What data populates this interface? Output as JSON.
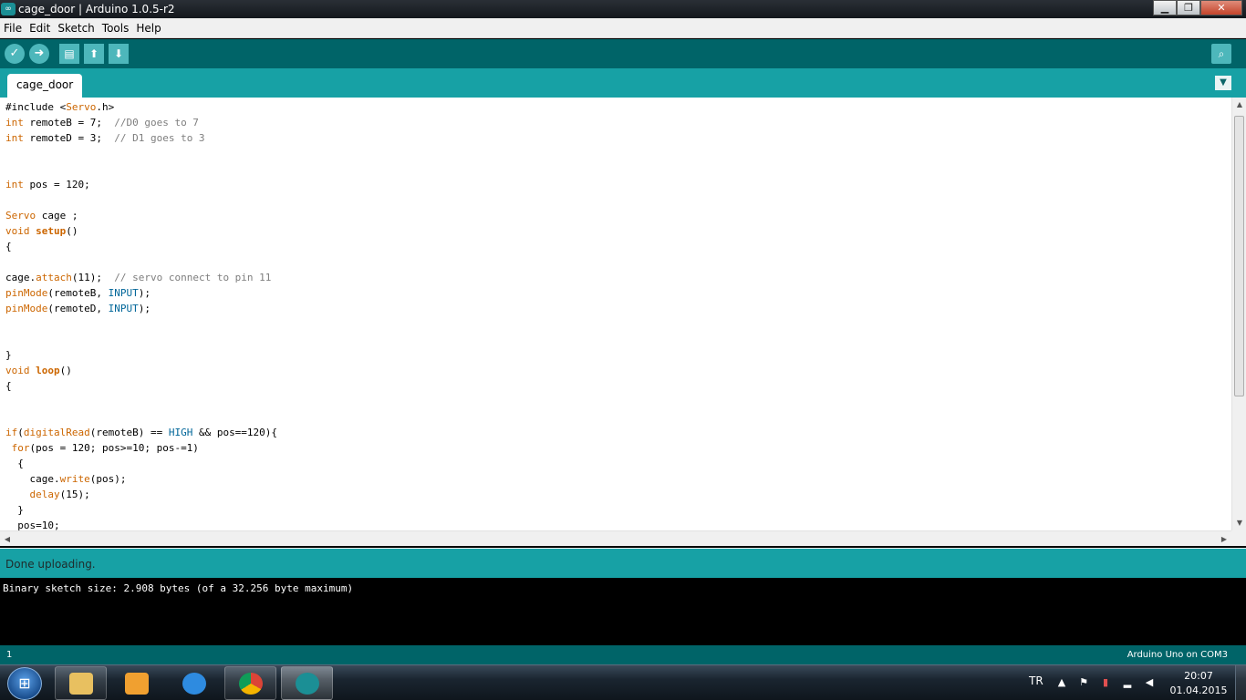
{
  "window": {
    "title": "cage_door | Arduino 1.0.5-r2"
  },
  "menubar": {
    "items": [
      "File",
      "Edit",
      "Sketch",
      "Tools",
      "Help"
    ]
  },
  "toolbar": {
    "buttons": [
      {
        "name": "verify",
        "icon": "checkmark-icon"
      },
      {
        "name": "upload",
        "icon": "right-arrow-icon"
      },
      {
        "name": "new",
        "icon": "page-icon"
      },
      {
        "name": "open",
        "icon": "up-arrow-icon"
      },
      {
        "name": "save",
        "icon": "down-arrow-icon"
      }
    ],
    "serial_monitor_icon": "magnifier-icon"
  },
  "tabs": [
    {
      "label": "cage_door",
      "active": true
    }
  ],
  "editor": {
    "lines": [
      "#include <Servo.h>",
      "int remoteB = 7;  //D0 goes to 7",
      "int remoteD = 3;  // D1 goes to 3",
      "",
      "",
      "int pos = 120;",
      "",
      "Servo cage ;",
      "void setup()",
      "{",
      "",
      "cage.attach(11);  // servo connect to pin 11",
      "pinMode(remoteB, INPUT);",
      "pinMode(remoteD, INPUT);",
      "",
      "",
      "}",
      "void loop()",
      "{",
      "",
      "",
      "if(digitalRead(remoteB) == HIGH && pos==120){",
      " for(pos = 120; pos>=10; pos-=1)",
      "  {",
      "    cage.write(pos);",
      "    delay(15);",
      "  }",
      "  pos=10;"
    ]
  },
  "status": {
    "message": "Done uploading."
  },
  "console": {
    "lines": [
      "Binary sketch size: 2.908 bytes (of a 32.256 byte maximum)"
    ]
  },
  "footer": {
    "line_number": "1",
    "board": "Arduino Uno on COM3"
  },
  "taskbar": {
    "apps": [
      "windows-explorer",
      "media-player",
      "internet-explorer",
      "chrome",
      "arduino"
    ],
    "language": "TR",
    "time": "20:07",
    "date": "01.04.2015"
  },
  "colors": {
    "toolbar": "#006468",
    "tabbar": "#17a1a5",
    "keyword": "#cc6600",
    "comment": "#7e7e7e",
    "constant": "#006699"
  }
}
